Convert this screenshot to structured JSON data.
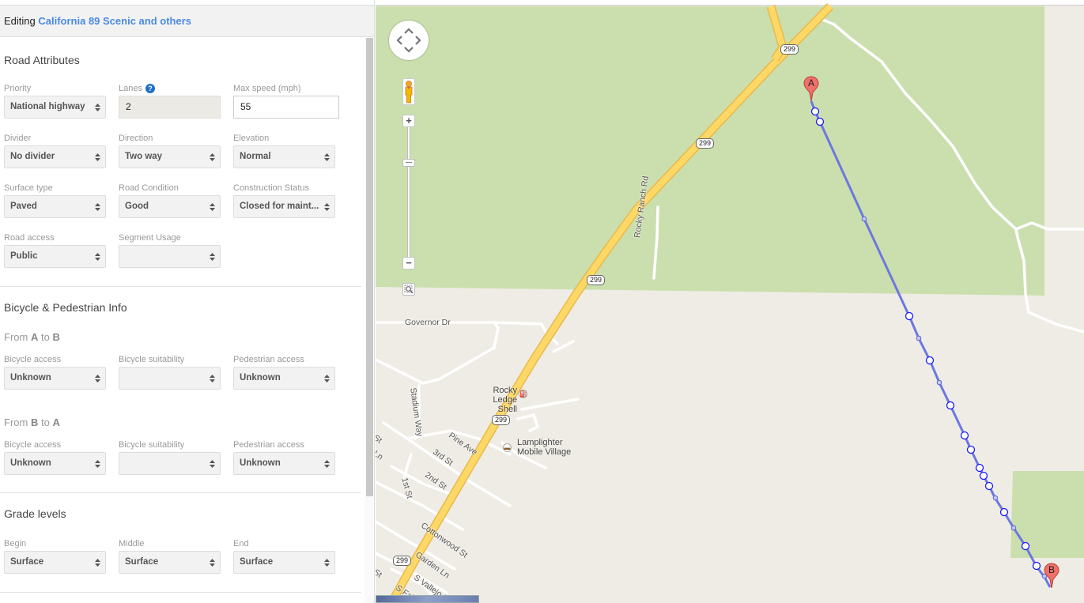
{
  "header": {
    "prefix": "Editing",
    "road_name": "California 89 Scenic and others"
  },
  "road_attributes": {
    "title": "Road Attributes",
    "fields": [
      {
        "label": "Priority",
        "value": "National highway",
        "type": "select"
      },
      {
        "label": "Lanes",
        "value": "2",
        "type": "readonly",
        "help": true
      },
      {
        "label": "Max speed (mph)",
        "value": "55",
        "type": "input"
      },
      {
        "label": "Divider",
        "value": "No divider",
        "type": "select"
      },
      {
        "label": "Direction",
        "value": "Two way",
        "type": "select"
      },
      {
        "label": "Elevation",
        "value": "Normal",
        "type": "select"
      },
      {
        "label": "Surface type",
        "value": "Paved",
        "type": "select"
      },
      {
        "label": "Road Condition",
        "value": "Good",
        "type": "select"
      },
      {
        "label": "Construction Status",
        "value": "Closed for maint...",
        "type": "select"
      },
      {
        "label": "Road access",
        "value": "Public",
        "type": "select"
      },
      {
        "label": "Segment Usage",
        "value": "",
        "type": "select"
      }
    ]
  },
  "bike_ped": {
    "title": "Bicycle & Pedestrian Info",
    "a_to_b": {
      "from_word": "From",
      "start": "A",
      "to_word": "to",
      "end": "B",
      "fields": [
        {
          "label": "Bicycle access",
          "value": "Unknown"
        },
        {
          "label": "Bicycle suitability",
          "value": ""
        },
        {
          "label": "Pedestrian access",
          "value": "Unknown"
        }
      ]
    },
    "b_to_a": {
      "from_word": "From",
      "start": "B",
      "to_word": "to",
      "end": "A",
      "fields": [
        {
          "label": "Bicycle access",
          "value": "Unknown"
        },
        {
          "label": "Bicycle suitability",
          "value": ""
        },
        {
          "label": "Pedestrian access",
          "value": "Unknown"
        }
      ]
    }
  },
  "grade_levels": {
    "title": "Grade levels",
    "fields": [
      {
        "label": "Begin",
        "value": "Surface"
      },
      {
        "label": "Middle",
        "value": "Surface"
      },
      {
        "label": "End",
        "value": "Surface"
      }
    ]
  },
  "map": {
    "colors": {
      "park": "#cbdfae",
      "land": "#efece5",
      "highway": "#fdd866",
      "highway_edge": "#e9b94a",
      "route": "#6b78e0",
      "marker": "#f0706a"
    },
    "markers": {
      "start": "A",
      "end": "B"
    },
    "route_shield": "299",
    "street_labels": [
      "Governor Dr",
      "Rocky Ranch Rd",
      "Stadium Way",
      "Pine Ave",
      "3rd St",
      "2nd St",
      "1st St",
      "Cottonwood St",
      "Garden Ln",
      "S Vallejo St",
      "S Fairfi",
      "St",
      "Ln",
      "St"
    ],
    "pois": [
      {
        "name_line1": "Rocky",
        "name_line2": "Ledge Shell",
        "icon": "gas-station-icon"
      },
      {
        "name_line1": "Lamplighter",
        "name_line2": "Mobile Village",
        "icon": "lodging-icon"
      }
    ],
    "controls": {
      "zoom_in": "+",
      "zoom_out": "−"
    }
  }
}
